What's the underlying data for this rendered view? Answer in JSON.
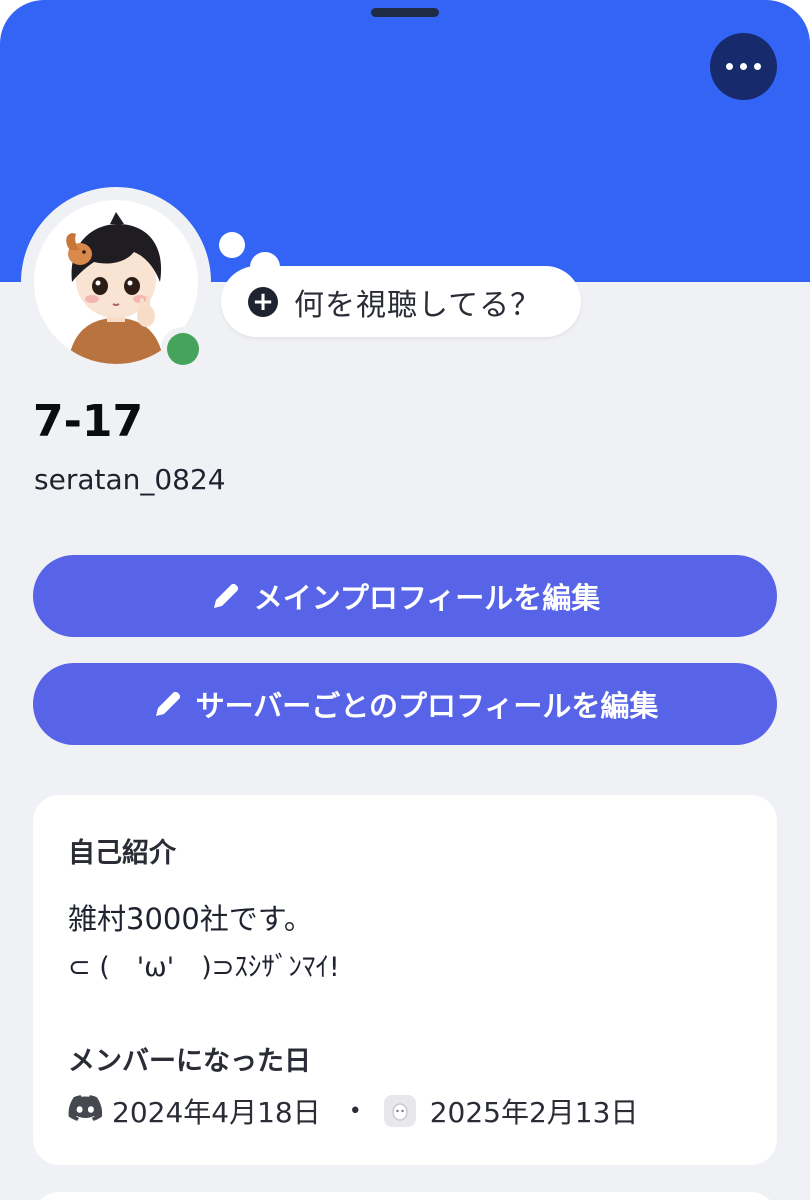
{
  "profile": {
    "display_name": "7-17",
    "username": "seratan_0824",
    "status": "online",
    "activity_prompt": "何を視聴してる？"
  },
  "buttons": {
    "edit_main_profile": "メインプロフィールを編集",
    "edit_server_profiles": "サーバーごとのプロフィールを編集"
  },
  "about": {
    "heading": "自己紹介",
    "line1": "雑村3000社です。",
    "line2": "⊂ (　'ω'　)⊃ｽｼｻﾞﾝﾏｲ!"
  },
  "member_since": {
    "heading": "メンバーになった日",
    "discord_date": "2024年4月18日",
    "separator": "•",
    "server_date": "2025年2月13日"
  },
  "colors": {
    "banner": "#3364f5",
    "button": "#5864e8",
    "status_online": "#45a35c",
    "more_button": "#172a6b"
  },
  "icons": {
    "more": "more-horizontal-icon",
    "add_activity": "plus-circle-icon",
    "edit": "pencil-icon",
    "discord": "discord-icon",
    "server": "server-icon"
  }
}
